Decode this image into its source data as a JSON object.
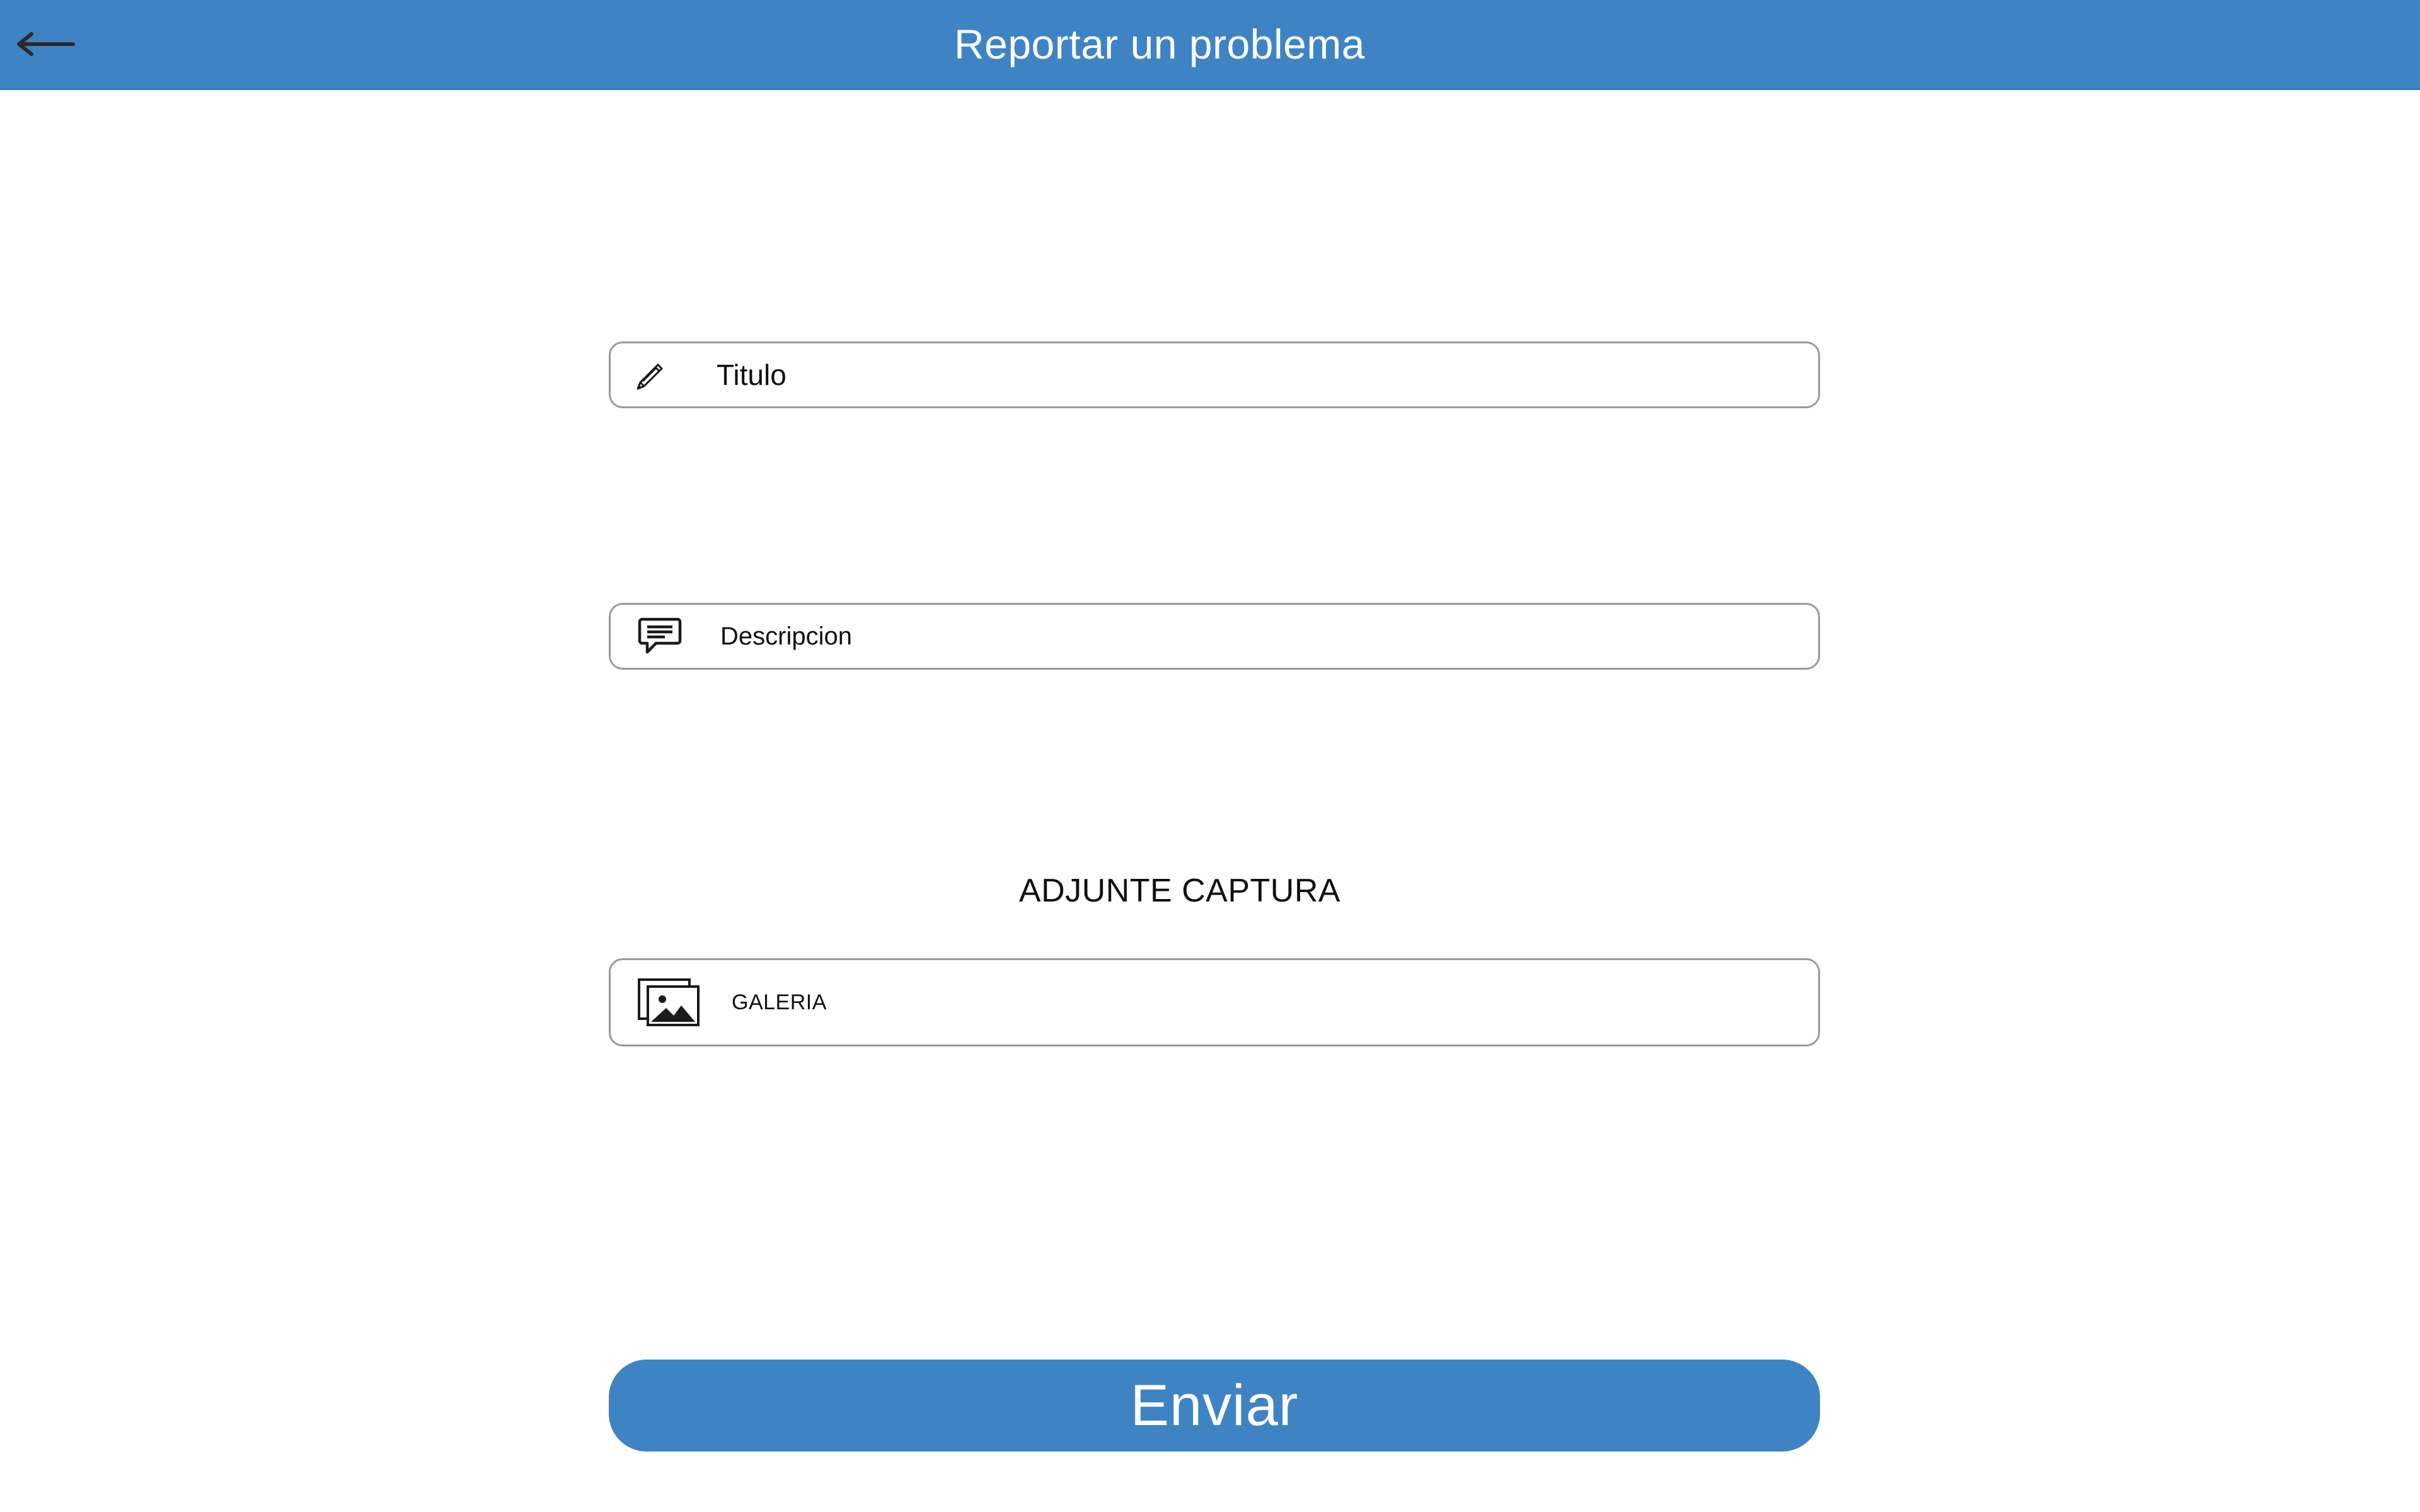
{
  "header": {
    "title": "Reportar un problema",
    "back_icon": "arrow-left-icon",
    "background_color": "#3e84c4"
  },
  "form": {
    "title_field": {
      "placeholder": "Titulo",
      "value": "",
      "icon": "pencil-icon"
    },
    "description_field": {
      "placeholder": "Descripcion",
      "value": "",
      "icon": "speech-bubble-icon"
    },
    "attachment": {
      "heading": "ADJUNTE CAPTURA",
      "gallery_label": "GALERIA",
      "gallery_icon": "image-gallery-icon"
    },
    "submit_label": "Enviar",
    "accent_color": "#3e84c4"
  }
}
